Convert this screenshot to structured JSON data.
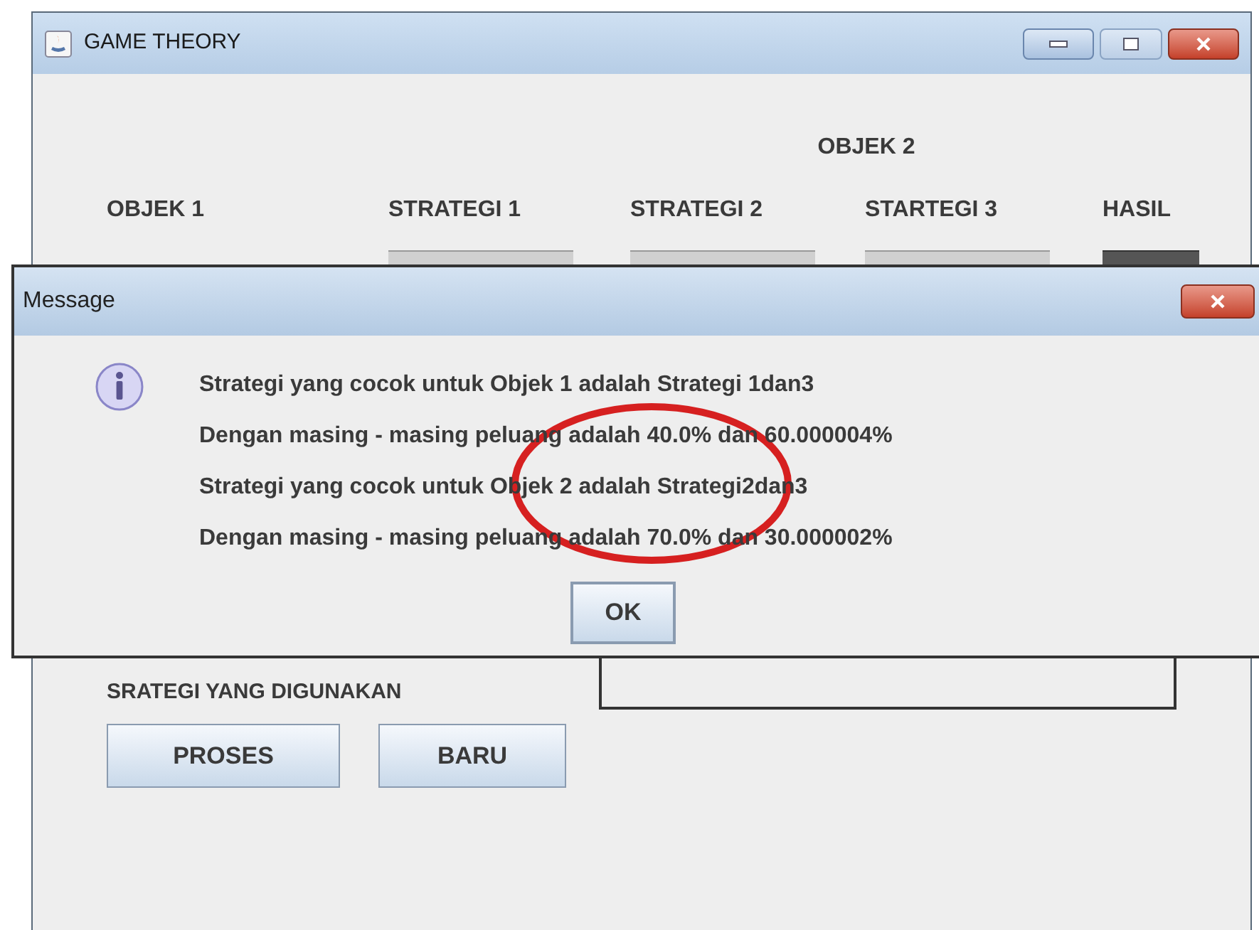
{
  "window": {
    "title": "GAME THEORY"
  },
  "header": {
    "group_label": "OBJEK 2",
    "columns": [
      "OBJEK 1",
      "STRATEGI 1",
      "STRATEGI 2",
      "STARTEGI 3",
      "HASIL"
    ]
  },
  "strategy_label": "SRATEGI YANG DIGUNAKAN",
  "buttons": [
    "PROSES",
    "BARU"
  ],
  "dialog": {
    "title": "Message",
    "lines": [
      "Strategi yang cocok untuk Objek 1 adalah Strategi 1dan3",
      "Dengan masing - masing peluang adalah 40.0% dan 60.000004%",
      "Strategi yang cocok untuk Objek 2 adalah Strategi2dan3",
      "Dengan masing - masing peluang adalah 70.0% dan 30.000002%"
    ],
    "button": "OK"
  }
}
